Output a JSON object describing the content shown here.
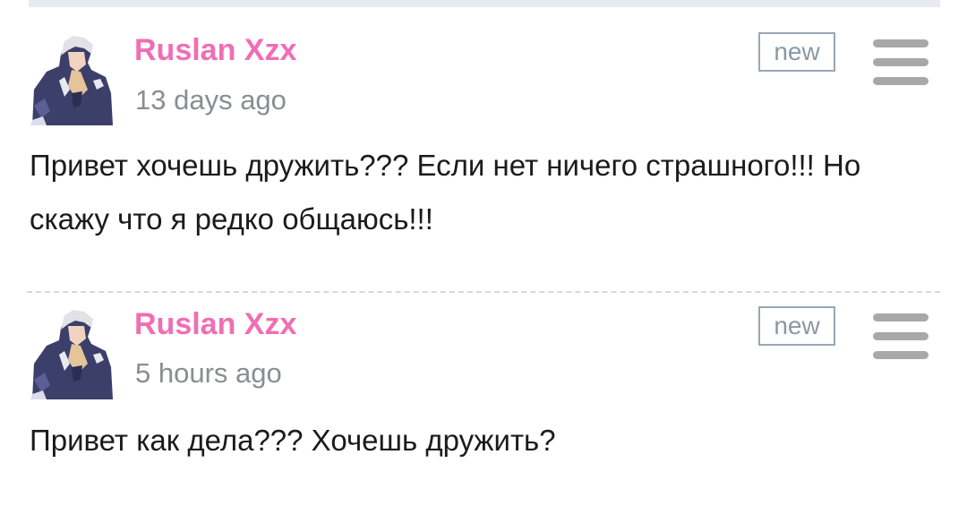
{
  "colors": {
    "author_name": "#f06eb4",
    "timestamp": "#8a8d91",
    "badge_border": "#9aa7b3",
    "menu_icon": "#a8a8a8",
    "divider": "#d5d8dd"
  },
  "comments": [
    {
      "author": "Ruslan Xzx",
      "time": "13 days ago",
      "badge": "new",
      "text": "Привет хочешь дружить??? Если нет ничего страшного!!! Но скажу что я редко общаюсь!!!",
      "avatar_icon": "anime-character-avatar-icon",
      "menu_icon": "hamburger-menu-icon"
    },
    {
      "author": "Ruslan Xzx",
      "time": "5 hours ago",
      "badge": "new",
      "text": "Привет как дела??? Хочешь дружить?",
      "avatar_icon": "anime-character-avatar-icon",
      "menu_icon": "hamburger-menu-icon"
    }
  ]
}
